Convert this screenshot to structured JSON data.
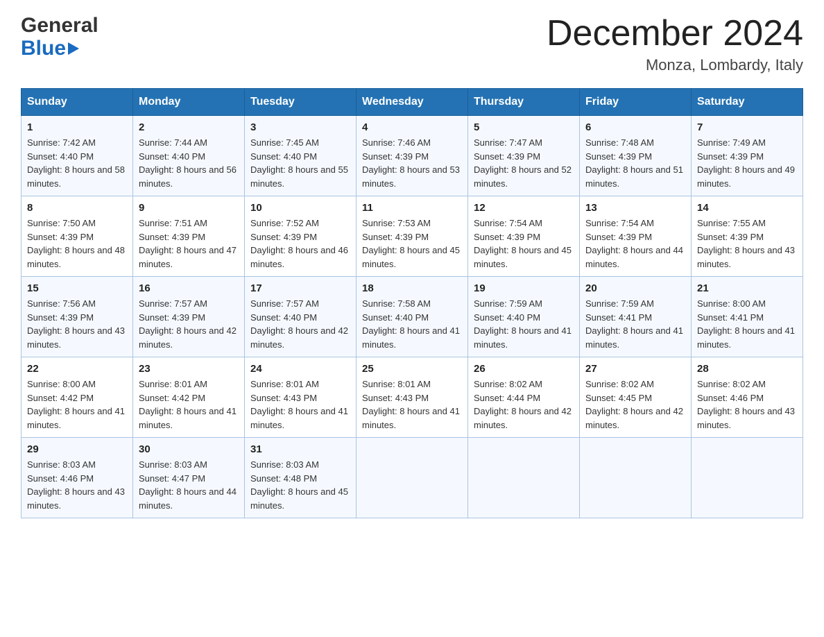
{
  "logo": {
    "general": "General",
    "blue": "Blue"
  },
  "header": {
    "title": "December 2024",
    "location": "Monza, Lombardy, Italy"
  },
  "days_of_week": [
    "Sunday",
    "Monday",
    "Tuesday",
    "Wednesday",
    "Thursday",
    "Friday",
    "Saturday"
  ],
  "weeks": [
    [
      {
        "day": "1",
        "sunrise": "7:42 AM",
        "sunset": "4:40 PM",
        "daylight": "8 hours and 58 minutes."
      },
      {
        "day": "2",
        "sunrise": "7:44 AM",
        "sunset": "4:40 PM",
        "daylight": "8 hours and 56 minutes."
      },
      {
        "day": "3",
        "sunrise": "7:45 AM",
        "sunset": "4:40 PM",
        "daylight": "8 hours and 55 minutes."
      },
      {
        "day": "4",
        "sunrise": "7:46 AM",
        "sunset": "4:39 PM",
        "daylight": "8 hours and 53 minutes."
      },
      {
        "day": "5",
        "sunrise": "7:47 AM",
        "sunset": "4:39 PM",
        "daylight": "8 hours and 52 minutes."
      },
      {
        "day": "6",
        "sunrise": "7:48 AM",
        "sunset": "4:39 PM",
        "daylight": "8 hours and 51 minutes."
      },
      {
        "day": "7",
        "sunrise": "7:49 AM",
        "sunset": "4:39 PM",
        "daylight": "8 hours and 49 minutes."
      }
    ],
    [
      {
        "day": "8",
        "sunrise": "7:50 AM",
        "sunset": "4:39 PM",
        "daylight": "8 hours and 48 minutes."
      },
      {
        "day": "9",
        "sunrise": "7:51 AM",
        "sunset": "4:39 PM",
        "daylight": "8 hours and 47 minutes."
      },
      {
        "day": "10",
        "sunrise": "7:52 AM",
        "sunset": "4:39 PM",
        "daylight": "8 hours and 46 minutes."
      },
      {
        "day": "11",
        "sunrise": "7:53 AM",
        "sunset": "4:39 PM",
        "daylight": "8 hours and 45 minutes."
      },
      {
        "day": "12",
        "sunrise": "7:54 AM",
        "sunset": "4:39 PM",
        "daylight": "8 hours and 45 minutes."
      },
      {
        "day": "13",
        "sunrise": "7:54 AM",
        "sunset": "4:39 PM",
        "daylight": "8 hours and 44 minutes."
      },
      {
        "day": "14",
        "sunrise": "7:55 AM",
        "sunset": "4:39 PM",
        "daylight": "8 hours and 43 minutes."
      }
    ],
    [
      {
        "day": "15",
        "sunrise": "7:56 AM",
        "sunset": "4:39 PM",
        "daylight": "8 hours and 43 minutes."
      },
      {
        "day": "16",
        "sunrise": "7:57 AM",
        "sunset": "4:39 PM",
        "daylight": "8 hours and 42 minutes."
      },
      {
        "day": "17",
        "sunrise": "7:57 AM",
        "sunset": "4:40 PM",
        "daylight": "8 hours and 42 minutes."
      },
      {
        "day": "18",
        "sunrise": "7:58 AM",
        "sunset": "4:40 PM",
        "daylight": "8 hours and 41 minutes."
      },
      {
        "day": "19",
        "sunrise": "7:59 AM",
        "sunset": "4:40 PM",
        "daylight": "8 hours and 41 minutes."
      },
      {
        "day": "20",
        "sunrise": "7:59 AM",
        "sunset": "4:41 PM",
        "daylight": "8 hours and 41 minutes."
      },
      {
        "day": "21",
        "sunrise": "8:00 AM",
        "sunset": "4:41 PM",
        "daylight": "8 hours and 41 minutes."
      }
    ],
    [
      {
        "day": "22",
        "sunrise": "8:00 AM",
        "sunset": "4:42 PM",
        "daylight": "8 hours and 41 minutes."
      },
      {
        "day": "23",
        "sunrise": "8:01 AM",
        "sunset": "4:42 PM",
        "daylight": "8 hours and 41 minutes."
      },
      {
        "day": "24",
        "sunrise": "8:01 AM",
        "sunset": "4:43 PM",
        "daylight": "8 hours and 41 minutes."
      },
      {
        "day": "25",
        "sunrise": "8:01 AM",
        "sunset": "4:43 PM",
        "daylight": "8 hours and 41 minutes."
      },
      {
        "day": "26",
        "sunrise": "8:02 AM",
        "sunset": "4:44 PM",
        "daylight": "8 hours and 42 minutes."
      },
      {
        "day": "27",
        "sunrise": "8:02 AM",
        "sunset": "4:45 PM",
        "daylight": "8 hours and 42 minutes."
      },
      {
        "day": "28",
        "sunrise": "8:02 AM",
        "sunset": "4:46 PM",
        "daylight": "8 hours and 43 minutes."
      }
    ],
    [
      {
        "day": "29",
        "sunrise": "8:03 AM",
        "sunset": "4:46 PM",
        "daylight": "8 hours and 43 minutes."
      },
      {
        "day": "30",
        "sunrise": "8:03 AM",
        "sunset": "4:47 PM",
        "daylight": "8 hours and 44 minutes."
      },
      {
        "day": "31",
        "sunrise": "8:03 AM",
        "sunset": "4:48 PM",
        "daylight": "8 hours and 45 minutes."
      },
      null,
      null,
      null,
      null
    ]
  ],
  "labels": {
    "sunrise": "Sunrise:",
    "sunset": "Sunset:",
    "daylight": "Daylight:"
  }
}
